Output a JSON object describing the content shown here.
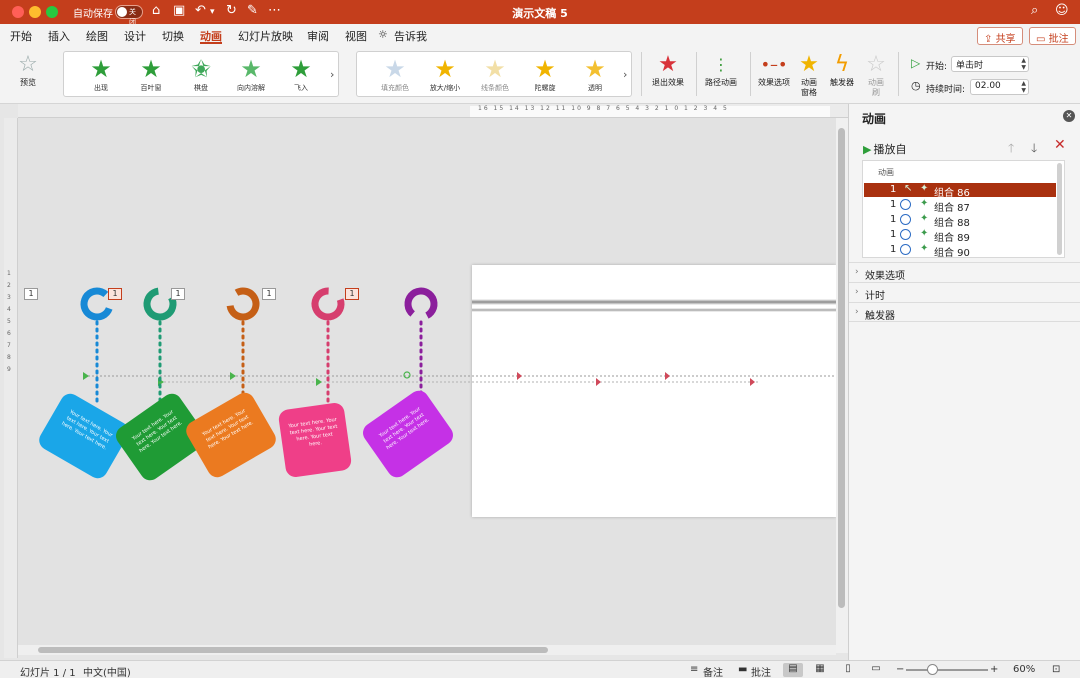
{
  "titlebar": {
    "autosave_label": "自动保存",
    "autosave_state": "关闭",
    "doc_title": "演示文稿 5"
  },
  "tabs": [
    "开始",
    "插入",
    "绘图",
    "设计",
    "切换",
    "动画",
    "幻灯片放映",
    "审阅",
    "视图",
    "告诉我"
  ],
  "active_tab": "动画",
  "header_buttons": {
    "share": "共享",
    "comments": "批注"
  },
  "ribbon": {
    "preview": "预览",
    "entrance_effects": [
      "出现",
      "百叶窗",
      "棋盘",
      "向内溶解",
      "飞入"
    ],
    "emphasis_effects": [
      "填充颜色",
      "放大/缩小",
      "线条颜色",
      "陀螺旋",
      "透明"
    ],
    "exit_effects": "退出效果",
    "motion_paths": "路径动画",
    "effect_options": "效果选项",
    "animation_pane_line1": "动画",
    "animation_pane_line2": "窗格",
    "trigger": "触发器",
    "animation_painter_line1": "动画",
    "animation_painter_line2": "刷",
    "start_label": "开始:",
    "start_value": "单击时",
    "duration_label": "持续时间:",
    "duration_value": "02.00"
  },
  "ruler": {
    "top_numbers": "16 15 14 13 12 11 10 9 8 7 6 5 4 3 2 1 0 1 2 3 4 5",
    "left_numbers": "1 2 3 4 5 6 7 8 9"
  },
  "slide": {
    "tag_text": "Your text here. Your text here. Your text here. Your text here.",
    "tag_colors": [
      "#1aa6e8",
      "#1f9b35",
      "#eb7a20",
      "#ef3f88",
      "#c531e6"
    ],
    "ring_colors": [
      "#1789d6",
      "#1f9b74",
      "#c55f16",
      "#d63e6e",
      "#8b1f9c"
    ],
    "badges": [
      "1",
      "1",
      "1",
      "1",
      "1"
    ]
  },
  "animation_pane": {
    "title": "动画",
    "play_from": "播放自",
    "list_header": "动画",
    "items": [
      {
        "order": "1",
        "name": "组合 86"
      },
      {
        "order": "1",
        "name": "组合 87"
      },
      {
        "order": "1",
        "name": "组合 88"
      },
      {
        "order": "1",
        "name": "组合 89"
      },
      {
        "order": "1",
        "name": "组合 90"
      }
    ],
    "sections": [
      "效果选项",
      "计时",
      "触发器"
    ]
  },
  "status": {
    "slide_info": "幻灯片 1 / 1",
    "language": "中文(中国)",
    "notes": "备注",
    "comments": "批注",
    "zoom": "60%"
  },
  "colors": {
    "accent": "#c43e1c",
    "selected_row": "#a9310f"
  }
}
